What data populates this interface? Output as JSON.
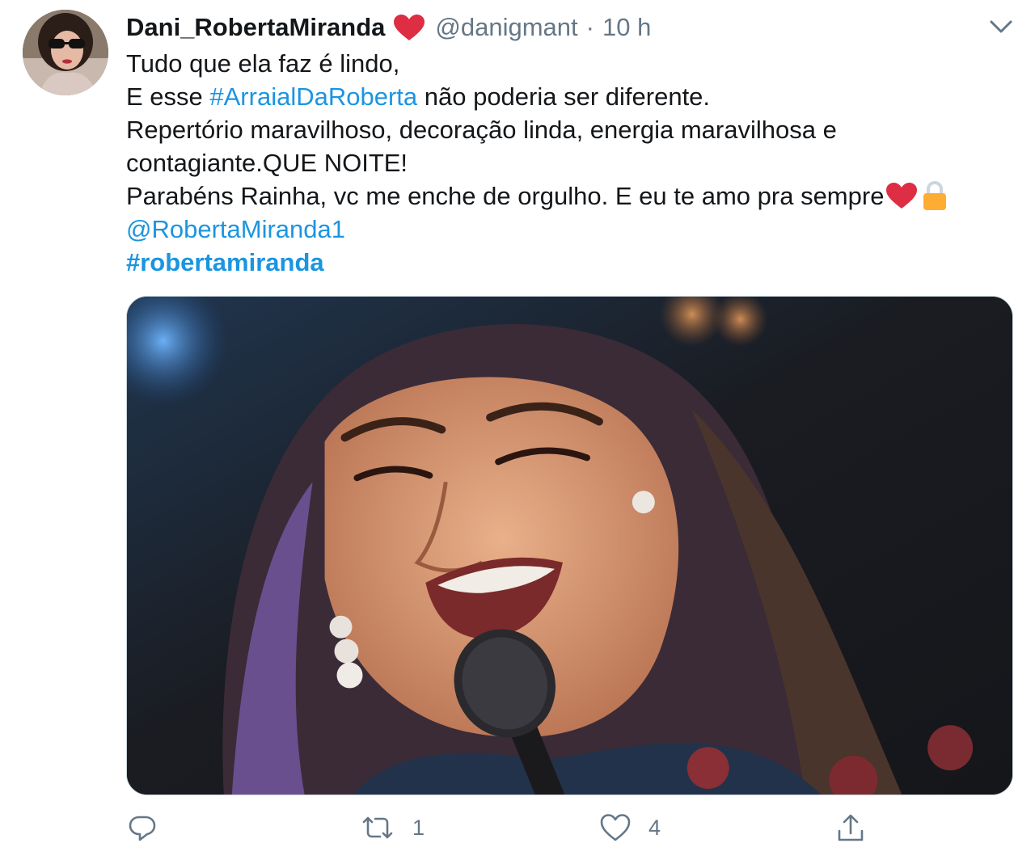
{
  "tweet": {
    "display_name": "Dani_RobertaMiranda",
    "handle": "@danigmant",
    "separator": "·",
    "time": "10 h",
    "lines": {
      "l1": "Tudo que ela faz é lindo,",
      "l2_pre": "E esse ",
      "l2_hashtag": "#ArraialDaRoberta",
      "l2_post": " não poderia ser diferente.",
      "l3": "Repertório maravilhoso, decoração linda, energia maravilhosa e",
      "l4": "contagiante.QUE NOITE!",
      "l5": "Parabéns Rainha, vc me enche de orgulho. E eu te amo pra sempre",
      "l6_mention": "@RobertaMiranda1",
      "l7_hashtag": "#robertamiranda"
    }
  },
  "actions": {
    "reply_count": "",
    "retweet_count": "1",
    "like_count": "4"
  },
  "icons": {
    "display_name_emoji": "red-heart-icon",
    "text_emojis": [
      "red-heart-icon",
      "lock-icon"
    ],
    "menu": "chevron-down-icon",
    "reply": "reply-icon",
    "retweet": "retweet-icon",
    "like": "like-icon",
    "share": "share-icon"
  },
  "colors": {
    "text": "#14171a",
    "secondary": "#657786",
    "link": "#1b95e0",
    "heart": "#e0245e"
  }
}
